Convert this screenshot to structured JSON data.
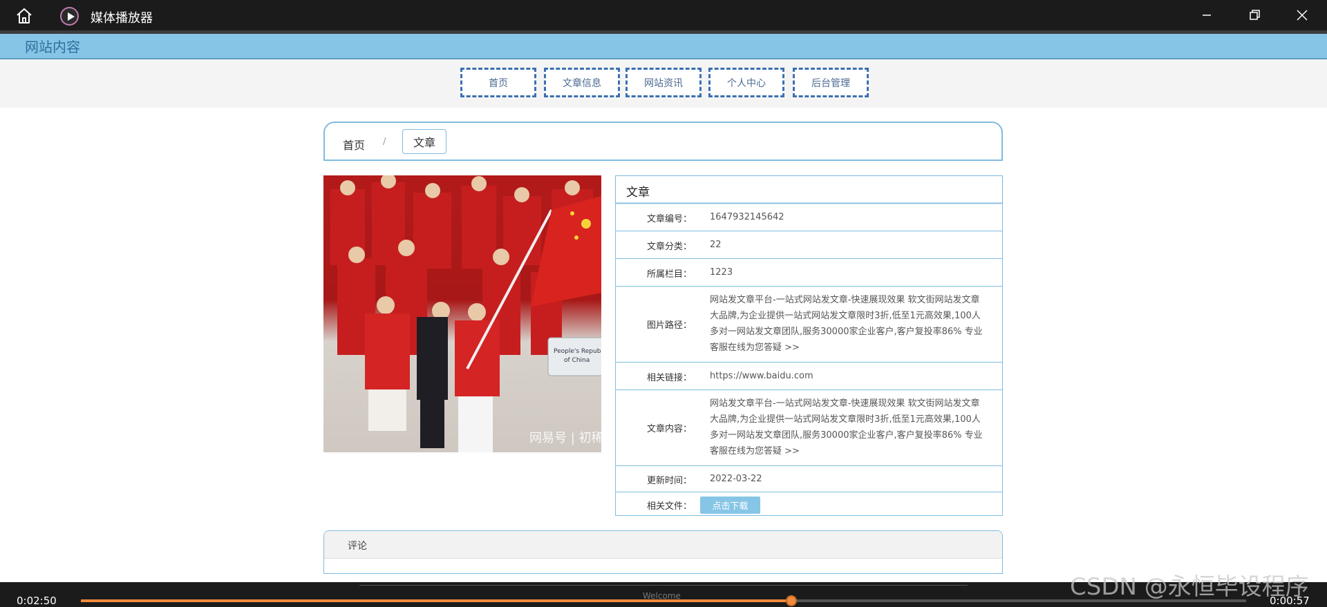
{
  "player": {
    "app_title": "媒体播放器",
    "current_time": "0:02:50",
    "end_time": "0:00:57",
    "progress_percent": 61,
    "colors": {
      "accent": "#f08a3c",
      "bar_bg": "#1b1b1b"
    }
  },
  "site": {
    "title": "网站内容",
    "header_color": "#87c5e6",
    "nav": [
      "首页",
      "文章信息",
      "网站资讯",
      "个人中心",
      "后台管理"
    ]
  },
  "breadcrumb": {
    "home": "首页",
    "separator": "/",
    "current": "文章"
  },
  "photo": {
    "sign_text": "People's Republic of China",
    "watermark_text": "网易号 | 初稀"
  },
  "detail": {
    "heading": "文章",
    "rows": [
      {
        "label": "文章编号：",
        "value": "1647932145642"
      },
      {
        "label": "文章分类：",
        "value": "22"
      },
      {
        "label": "所属栏目：",
        "value": "1223"
      },
      {
        "label": "图片路径：",
        "value": "网站发文章平台-一站式网站发文章-快速展现效果 软文街网站发文章大品牌,为企业提供一站式网站发文章限时3折,低至1元高效果,100人多对一网站发文章团队,服务30000家企业客户,客户复投率86% 专业客服在线为您答疑 >>"
      },
      {
        "label": "相关链接：",
        "value": "https://www.baidu.com"
      },
      {
        "label": "文章内容：",
        "value": "网站发文章平台-一站式网站发文章-快速展现效果 软文街网站发文章大品牌,为企业提供一站式网站发文章限时3折,低至1元高效果,100人多对一网站发文章团队,服务30000家企业客户,客户复投率86% 专业客服在线为您答疑 >>"
      },
      {
        "label": "更新时间：",
        "value": "2022-03-22"
      },
      {
        "label": "相关文件：",
        "value": ""
      }
    ],
    "download_label": "点击下载"
  },
  "comments": {
    "heading": "评论"
  },
  "footer": {
    "text": "Welcome"
  },
  "watermark": "CSDN @永恒毕设程序"
}
